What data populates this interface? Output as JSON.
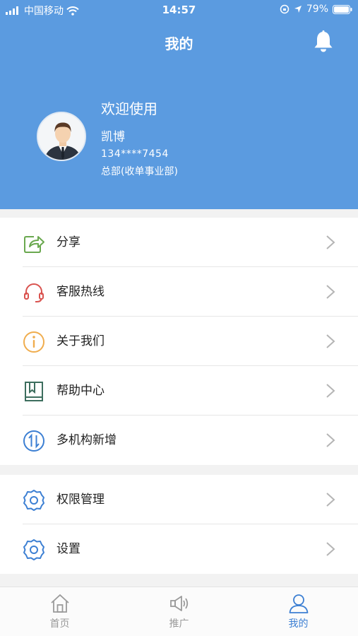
{
  "status_bar": {
    "carrier": "中国移动",
    "time": "14:57",
    "battery": "79%",
    "battery_level": 0.79
  },
  "header": {
    "title": "我的"
  },
  "profile": {
    "welcome": "欢迎使用",
    "name": "凯博",
    "phone": "134****7454",
    "dept": "总部(收单事业部)"
  },
  "menu_group_1": [
    {
      "label": "分享",
      "icon": "share-icon",
      "color": "#6aa84f"
    },
    {
      "label": "客服热线",
      "icon": "headset-icon",
      "color": "#d9534f"
    },
    {
      "label": "关于我们",
      "icon": "info-icon",
      "color": "#f0ad4e"
    },
    {
      "label": "帮助中心",
      "icon": "book-icon",
      "color": "#3d6e5e"
    },
    {
      "label": "多机构新增",
      "icon": "switch-icon",
      "color": "#3c7fd3"
    }
  ],
  "menu_group_2": [
    {
      "label": "权限管理",
      "icon": "gear-icon",
      "color": "#3c7fd3"
    },
    {
      "label": "设置",
      "icon": "gear-icon",
      "color": "#3c7fd3"
    }
  ],
  "tabbar": [
    {
      "label": "首页",
      "icon": "home-icon",
      "active": false
    },
    {
      "label": "推广",
      "icon": "megaphone-icon",
      "active": false
    },
    {
      "label": "我的",
      "icon": "user-icon",
      "active": true
    }
  ],
  "colors": {
    "header_bg": "#5b9be0",
    "accent": "#3c7fd3"
  }
}
